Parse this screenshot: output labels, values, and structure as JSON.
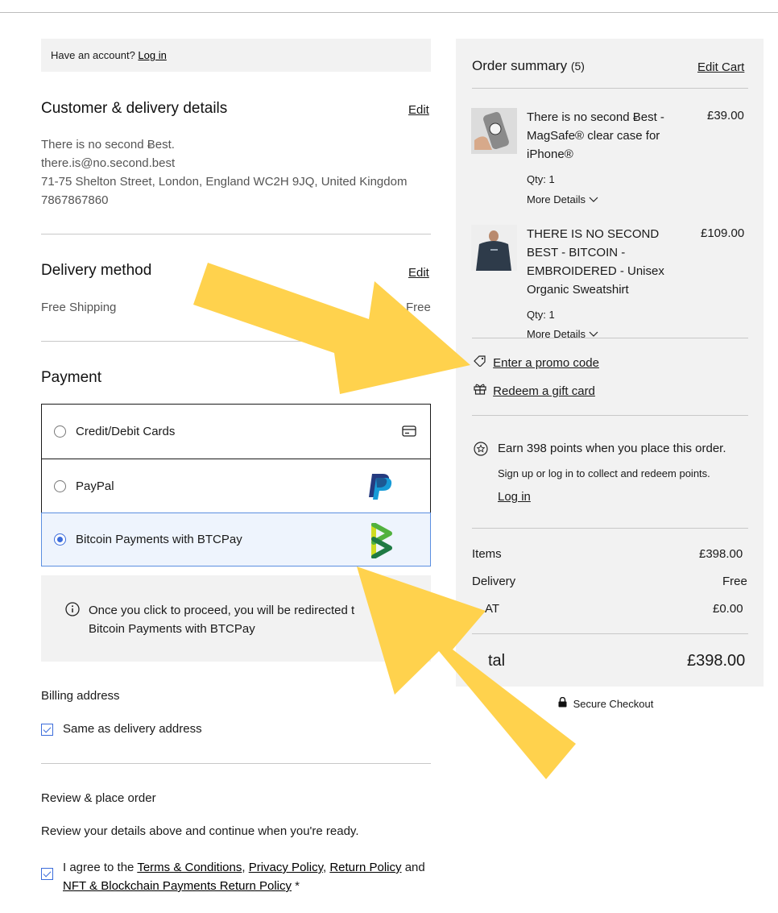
{
  "account": {
    "prompt": "Have an account?",
    "login_label": "Log in"
  },
  "customer": {
    "title": "Customer & delivery details",
    "edit_label": "Edit",
    "name": "There is no second Ƀest.",
    "email": "there.is@no.second.best",
    "address": "71-75 Shelton Street, London, England WC2H 9JQ, United Kingdom",
    "phone": "7867867860"
  },
  "delivery": {
    "title": "Delivery method",
    "edit_label": "Edit",
    "method": "Free Shipping",
    "price": "Free"
  },
  "payment": {
    "title": "Payment",
    "options": [
      {
        "label": "Credit/Debit Cards",
        "icon": "credit-card-icon",
        "selected": false
      },
      {
        "label": "PayPal",
        "icon": "paypal-logo",
        "selected": false
      },
      {
        "label": "Bitcoin Payments with BTCPay",
        "icon": "btcpay-logo",
        "selected": true
      }
    ],
    "info_line1": "Once you click to proceed, you will be redirected t",
    "info_line2": "Bitcoin Payments with BTCPay"
  },
  "billing": {
    "title": "Billing address",
    "same_label": "Same as delivery address"
  },
  "review": {
    "title": "Review & place order",
    "text": "Review your details above and continue when you're ready.",
    "agree_prefix": "I agree to the",
    "terms": "Terms & Conditions",
    "comma1": ",",
    "privacy": "Privacy Policy",
    "comma2": ",",
    "return": "Return Policy",
    "and": "and",
    "nft": "NFT & Blockchain Payments Return Policy",
    "required_mark": "*"
  },
  "summary": {
    "title": "Order summary",
    "count": "(5)",
    "edit_cart_label": "Edit Cart",
    "items": [
      {
        "name_lines": [
          "There is no second Ƀest -",
          "MagSafe® clear case for",
          "iPhone®"
        ],
        "price": "£39.00",
        "qty": "Qty: 1",
        "details_label": "More Details"
      },
      {
        "name_lines": [
          "THERE IS NO SECOND",
          "BEST - BITCOIN -",
          "EMBROIDERED - Unisex",
          "Organic Sweatshirt"
        ],
        "price": "£109.00",
        "qty": "Qty: 1",
        "details_label": "More Details"
      }
    ],
    "promo_label": "Enter a promo code",
    "gift_label": "Redeem a gift card",
    "points_text": "Earn 398 points when you place this order.",
    "points_sub": "Sign up or log in to collect and redeem points.",
    "points_login": "Log in",
    "items_label": "Items",
    "items_value": "£398.00",
    "delivery_label": "Delivery",
    "delivery_value": "Free",
    "vat_label": "AT",
    "vat_value": "£0.00",
    "total_label": "tal",
    "total_value": "£398.00",
    "secure_label": "Secure Checkout"
  },
  "colors": {
    "arrow": "#ffd24d",
    "accent": "#3b6cdb",
    "panel": "#f2f2f2"
  }
}
